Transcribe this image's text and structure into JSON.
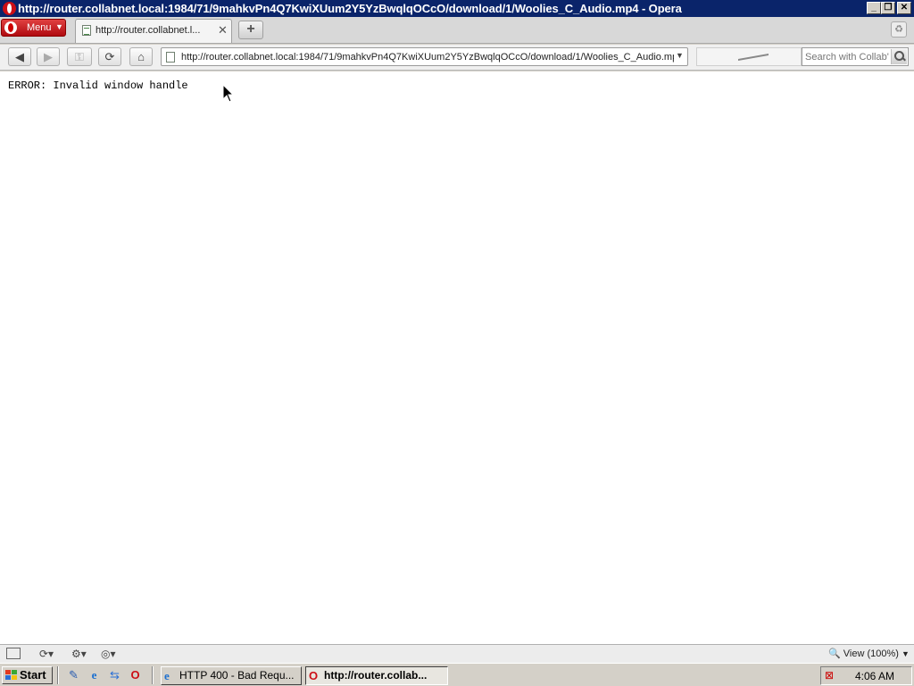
{
  "window": {
    "title": "http://router.collabnet.local:1984/71/9mahkvPn4Q7KwiXUum2Y5YzBwqlqOCcO/download/1/Woolies_C_Audio.mp4 - Opera",
    "minimize": "_",
    "maximize": "❐",
    "close": "✕"
  },
  "tabbar": {
    "menu_label": "Menu",
    "tab_label": "http://router.collabnet.l...",
    "tab_close": "✕",
    "new_tab": "+"
  },
  "navbar": {
    "address_value": "http://router.collabnet.local:1984/71/9mahkvPn4Q7KwiXUum2Y5YzBwqlqOCcO/download/1/Woolies_C_Audio.mp4",
    "search_placeholder": "Search with Collab'"
  },
  "content": {
    "error_text": "ERROR: Invalid window handle"
  },
  "statusbar": {
    "zoom_label": "View (100%)"
  },
  "taskbar": {
    "start_label": "Start",
    "tasks": [
      {
        "label": "HTTP 400 - Bad Requ...",
        "active": false
      },
      {
        "label": "http://router.collab...",
        "active": true
      }
    ],
    "clock": "4:06 AM"
  },
  "colors": {
    "titlebar": "#0a246a",
    "opera_red": "#cc0f16",
    "content_bg": "#ffffff"
  }
}
